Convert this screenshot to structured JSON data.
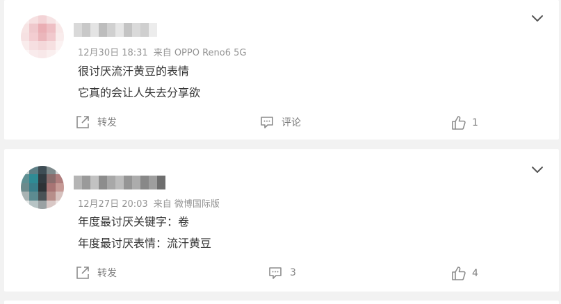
{
  "colors": {
    "page_background": "#f2f2f2",
    "card_background": "#ffffff",
    "meta_text": "#939393",
    "body_text": "#333333",
    "action_text": "#808080"
  },
  "comments": [
    {
      "avatar": "pixelated-avatar",
      "username_blurred": true,
      "date": "12月30日 18:31",
      "source": "来自 OPPO Reno6 5G",
      "lines": [
        "很讨厌流汗黄豆的表情",
        "它真的会让人失去分享欲"
      ],
      "actions": {
        "repost_label": "转发",
        "comment_label": "评论",
        "like_count": "1"
      }
    },
    {
      "avatar": "pixelated-avatar",
      "username_blurred": true,
      "date": "12月27日 20:03",
      "source": "来自 微博国际版",
      "lines": [
        "年度最讨厌关键字：卷",
        "年度最讨厌表情：流汗黄豆"
      ],
      "actions": {
        "repost_label": "转发",
        "comment_label": "3",
        "like_count": "4"
      }
    }
  ]
}
